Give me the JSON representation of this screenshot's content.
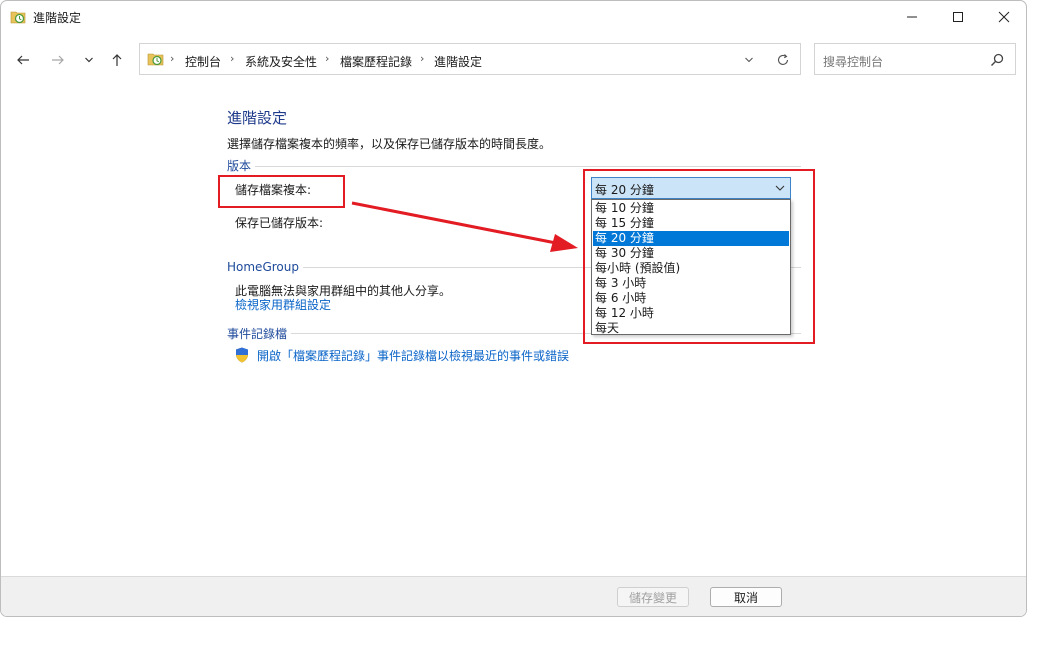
{
  "window": {
    "title": "進階設定",
    "controls": {
      "minimize": "minimize-icon",
      "maximize": "maximize-icon",
      "close": "close-icon"
    }
  },
  "address": {
    "breadcrumbs": [
      "控制台",
      "系統及安全性",
      "檔案歷程記錄",
      "進階設定"
    ]
  },
  "search": {
    "placeholder": "搜尋控制台"
  },
  "page": {
    "title": "進階設定",
    "description": "選擇儲存檔案複本的頻率，以及保存已儲存版本的時間長度。"
  },
  "versions": {
    "group_label": "版本",
    "save_copies_label": "儲存檔案複本:",
    "keep_versions_label": "保存已儲存版本:",
    "selected_frequency": "每 20 分鐘",
    "frequency_options": [
      "每 10 分鐘",
      "每 15 分鐘",
      "每 20 分鐘",
      "每 30 分鐘",
      "每小時 (預設值)",
      "每 3 小時",
      "每 6 小時",
      "每 12 小時",
      "每天"
    ],
    "highlighted_index": 2
  },
  "homegroup": {
    "group_label": "HomeGroup",
    "text": "此電腦無法與家用群組中的其他人分享。",
    "link": "檢視家用群組設定"
  },
  "eventlog": {
    "group_label": "事件記錄檔",
    "link": "開啟「檔案歷程記錄」事件記錄檔以檢視最近的事件或錯誤"
  },
  "footer": {
    "save_label": "儲存變更",
    "cancel_label": "取消"
  },
  "colors": {
    "accent": "#0078d7",
    "link": "#0a64c8",
    "heading": "#1e3a8a",
    "annotation": "#e31b23"
  }
}
